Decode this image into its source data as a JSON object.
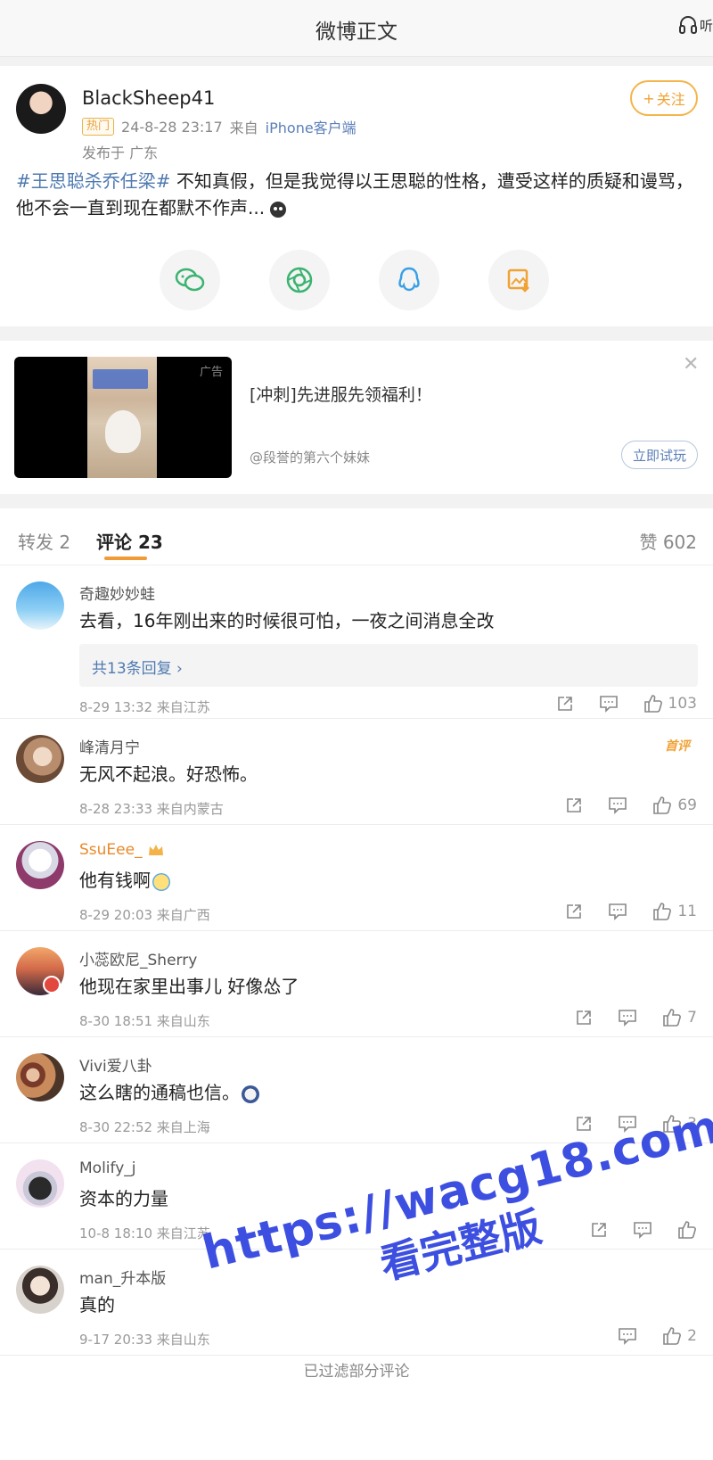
{
  "header": {
    "title": "微博正文",
    "listen_label": "听"
  },
  "post": {
    "author": "BlackSheep41",
    "hot_badge": "热门",
    "timestamp": "24-8-28 23:17",
    "source_prefix": "来自",
    "source_app": "iPhone客户端",
    "location": "发布于 广东",
    "follow_label": "关注",
    "topic": "#王思聪杀乔任梁#",
    "text": " 不知真假，但是我觉得以王思聪的性格，遭受这样的质疑和谩骂，他不会一直到现在都默不作声...",
    "share_icons": [
      "wechat-icon",
      "moments-icon",
      "qq-icon",
      "save-image-icon"
    ]
  },
  "ad": {
    "tag": "广告",
    "title": "[冲刺]先进服先领福利！",
    "author": "@段誉的第六个妹妹",
    "cta": "立即试玩"
  },
  "tabs": {
    "repost": "转发 2",
    "comments": "评论 23",
    "likes": "赞 602"
  },
  "comments": [
    {
      "name": "奇趣妙妙蛙",
      "text": "去看，16年刚出来的时候很可怕，一夜之间消息全改",
      "replies": "共13条回复 ›",
      "time": "8-29 13:32 来自江苏",
      "likes": "103"
    },
    {
      "name": "峰清月宁",
      "badge": "首评",
      "text": "无风不起浪。好恐怖。",
      "time": "8-28 23:33 来自内蒙古",
      "likes": "69"
    },
    {
      "name": "SsuEee_",
      "text": "他有钱啊",
      "time": "8-29 20:03 来自广西",
      "likes": "11"
    },
    {
      "name": "小蕊欧尼_Sherry",
      "text": "他现在家里出事儿 好像怂了",
      "time": "8-30 18:51 来自山东",
      "likes": "7"
    },
    {
      "name": "Vivi爱八卦",
      "text": "这么瞎的通稿也信。",
      "time": "8-30 22:52 来自上海",
      "likes": "3"
    },
    {
      "name": "Molify_j",
      "text": "资本的力量",
      "time": "10-8 18:10 来自江苏",
      "likes": ""
    },
    {
      "name": "man_升本版",
      "text": "真的",
      "time": "9-17 20:33 来自山东",
      "likes": "2"
    }
  ],
  "footer": {
    "text": "已过滤部分评论"
  },
  "watermark": {
    "url": "https://wacg18.com",
    "text": "看完整版"
  },
  "colors": {
    "accent": "#f09a38",
    "link": "#4f7ab0",
    "watermark": "#3d4fe0"
  }
}
